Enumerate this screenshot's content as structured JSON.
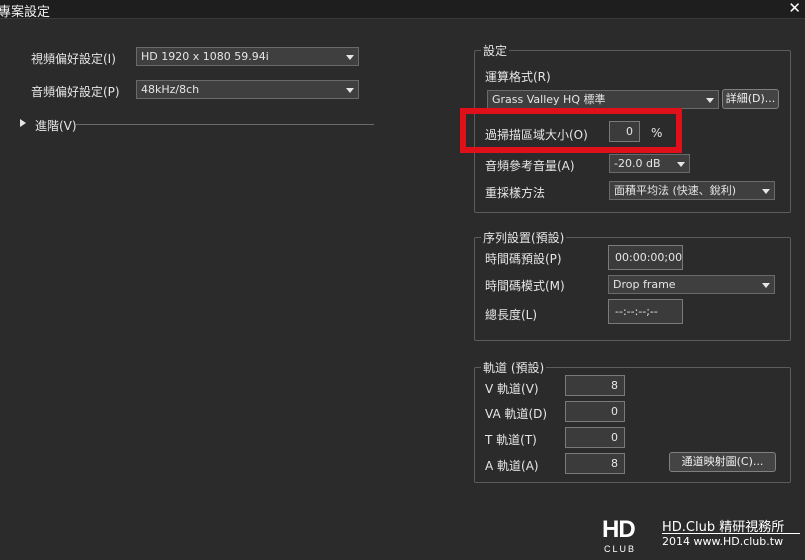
{
  "window": {
    "title": "專案設定",
    "close_glyph": "✕"
  },
  "left": {
    "video_label": "視頻偏好設定(I)",
    "video_value": "HD 1920 x 1080 59.94i",
    "audio_label": "音頻偏好設定(P)",
    "audio_value": "48kHz/8ch",
    "advanced_label": "進階(V)"
  },
  "settings": {
    "title": "設定",
    "render_format_label": "運算格式(R)",
    "render_format_value": "Grass Valley HQ 標準",
    "details_button": "詳細(D)...",
    "overscan_label": "過掃描區域大小(O)",
    "overscan_value": "0",
    "overscan_unit": "%",
    "audio_ref_label": "音頻參考音量(A)",
    "audio_ref_value": "-20.0 dB",
    "resample_label": "重採樣方法",
    "resample_value": "面積平均法 (快速、銳利)"
  },
  "sequence": {
    "title": "序列設置(預設)",
    "timecode_preset_label": "時間碼預設(P)",
    "timecode_preset_value": "00:00:00;00",
    "timecode_mode_label": "時間碼模式(M)",
    "timecode_mode_value": "Drop frame",
    "total_length_label": "總長度(L)",
    "total_length_value": "--:--:--;--"
  },
  "tracks": {
    "title": "軌道 (預設)",
    "rows": [
      {
        "label": "V 軌道(V)",
        "value": "8"
      },
      {
        "label": "VA 軌道(D)",
        "value": "0"
      },
      {
        "label": "T 軌道(T)",
        "value": "0"
      },
      {
        "label": "A 軌道(A)",
        "value": "8"
      }
    ],
    "channel_map_button": "通道映射圖(C)..."
  },
  "watermark": {
    "logo": "HD",
    "club": "CLUB",
    "name": "HD.Club 精研視務所",
    "url": "2014 www.HD.club.tw"
  },
  "colors": {
    "highlight": "#e0101a",
    "background": "#2b2b2b"
  }
}
